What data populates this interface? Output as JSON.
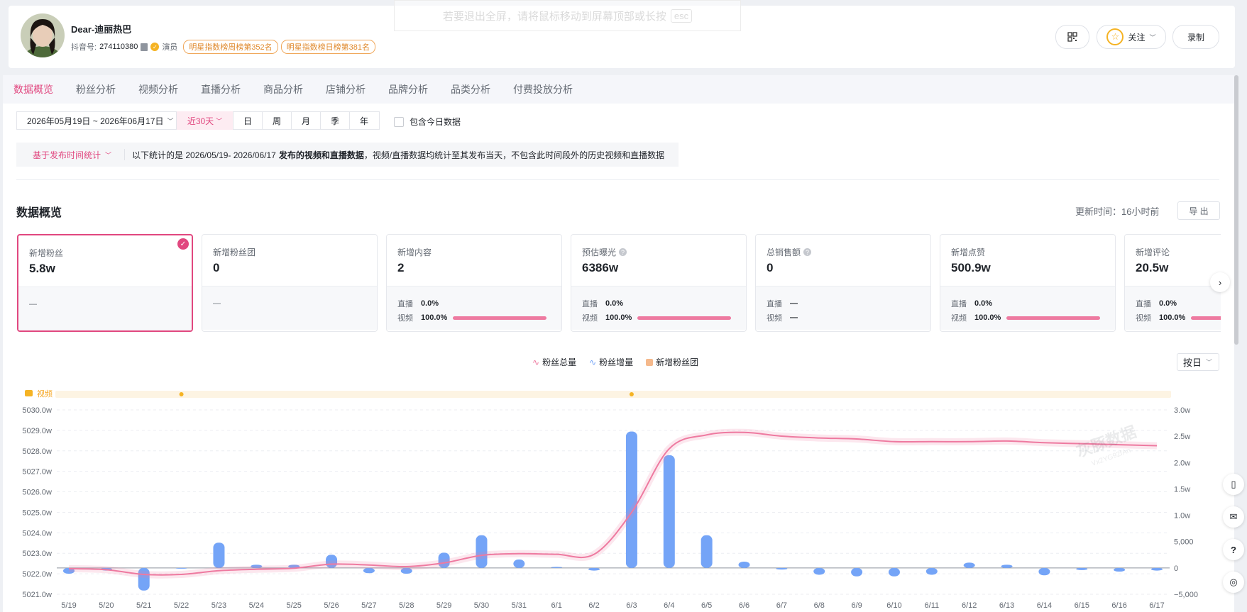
{
  "profile": {
    "name": "Dear-迪丽热巴",
    "douyin_label": "抖音号:",
    "douyin_id": "274110380",
    "role": "演员",
    "badges": [
      "明星指数榜周榜第352名",
      "明星指数榜日榜第381名"
    ]
  },
  "header_actions": {
    "follow": "关注",
    "record": "录制"
  },
  "toast": {
    "text": "若要退出全屏，请将鼠标移动到屏幕顶部或长按",
    "key": "esc"
  },
  "tabs": [
    "数据概览",
    "粉丝分析",
    "视频分析",
    "直播分析",
    "商品分析",
    "店铺分析",
    "品牌分析",
    "品类分析",
    "付费投放分析"
  ],
  "filters": {
    "date_range": "2026年05月19日 ~ 2026年06月17日",
    "recent": "近30天",
    "periods": [
      "日",
      "周",
      "月",
      "季",
      "年"
    ],
    "include_today": "包含今日数据"
  },
  "notice": {
    "mode": "基于发布时间统计",
    "prefix": "以下统计的是 2026/05/19- 2026/06/17",
    "bold": "发布的视频和直播数据",
    "suffix": "，视频/直播数据均统计至其发布当天，不包含此时间段外的历史视频和直播数据"
  },
  "overview": {
    "title": "数据概览",
    "update_label": "更新时间：",
    "update_value": "16小时前",
    "export": "导 出"
  },
  "cards": [
    {
      "label": "新增粉丝",
      "value": "5.8w",
      "dash": "—"
    },
    {
      "label": "新增粉丝团",
      "value": "0",
      "dash": "—"
    },
    {
      "label": "新增内容",
      "value": "2",
      "live_label": "直播",
      "live": "0.0%",
      "video_label": "视频",
      "video": "100.0%",
      "video_share": 1.0
    },
    {
      "label": "预估曝光",
      "value": "6386w",
      "live_label": "直播",
      "live": "0.0%",
      "video_label": "视频",
      "video": "100.0%",
      "video_share": 1.0
    },
    {
      "label": "总销售额",
      "value": "0",
      "live_label": "直播",
      "live": "—",
      "video_label": "视频",
      "video": "—"
    },
    {
      "label": "新增点赞",
      "value": "500.9w",
      "live_label": "直播",
      "live": "0.0%",
      "video_label": "视频",
      "video": "100.0%",
      "video_share": 1.0
    },
    {
      "label": "新增评论",
      "value": "20.5w",
      "live_label": "直播",
      "live": "0.0%",
      "video_label": "视频",
      "video": "100.0%",
      "video_share": 1.0
    }
  ],
  "chart_select": "按日",
  "watermark": {
    "brand": "灰豚数据",
    "code": "Vx2YG92fAn"
  },
  "chart_data": {
    "type": "bar+line",
    "legend": [
      "粉丝总量",
      "粉丝增量",
      "新增粉丝团"
    ],
    "legend_position": "top-center",
    "video_track_label": "视频",
    "video_markers": [
      "5/22",
      "6/3"
    ],
    "categories": [
      "5/19",
      "5/20",
      "5/21",
      "5/22",
      "5/23",
      "5/24",
      "5/25",
      "5/26",
      "5/27",
      "5/28",
      "5/29",
      "5/30",
      "5/31",
      "6/1",
      "6/2",
      "6/3",
      "6/4",
      "6/5",
      "6/6",
      "6/7",
      "6/8",
      "6/9",
      "6/10",
      "6/11",
      "6/12",
      "6/13",
      "6/14",
      "6/15",
      "6/16",
      "6/17"
    ],
    "y_left": {
      "ticks": [
        "5021.0w",
        "5022.0w",
        "5023.0w",
        "5024.0w",
        "5025.0w",
        "5026.0w",
        "5027.0w",
        "5028.0w",
        "5029.0w",
        "5030.0w"
      ],
      "range": [
        5021.0,
        5030.0
      ]
    },
    "y_right": {
      "ticks": [
        "−5,000",
        "0",
        "5,000",
        "1.0w",
        "1.5w",
        "2.0w",
        "2.5w",
        "3.0w"
      ],
      "range": [
        -5000,
        30000
      ]
    },
    "series": [
      {
        "name": "粉丝增量",
        "type": "bar",
        "color": "#74a4f7",
        "values": [
          -1100,
          -500,
          -4300,
          0,
          4800,
          600,
          600,
          2500,
          -1000,
          -1100,
          2900,
          6200,
          1600,
          200,
          -500,
          25900,
          21400,
          6200,
          1200,
          -300,
          -1300,
          -1600,
          -1600,
          -1300,
          1000,
          600,
          -1400,
          -400,
          -700,
          -500
        ]
      },
      {
        "name": "粉丝总量",
        "type": "line",
        "color": "#ee7aa0",
        "values": [
          5022.25,
          5022.2,
          5021.97,
          5021.97,
          5022.15,
          5022.22,
          5022.27,
          5022.47,
          5022.43,
          5022.35,
          5022.53,
          5022.9,
          5022.98,
          5022.95,
          5022.95,
          5025.0,
          5028.1,
          5028.78,
          5028.9,
          5028.72,
          5028.63,
          5028.58,
          5028.45,
          5028.45,
          5028.45,
          5028.48,
          5028.4,
          5028.35,
          5028.3,
          5028.25
        ]
      }
    ]
  }
}
